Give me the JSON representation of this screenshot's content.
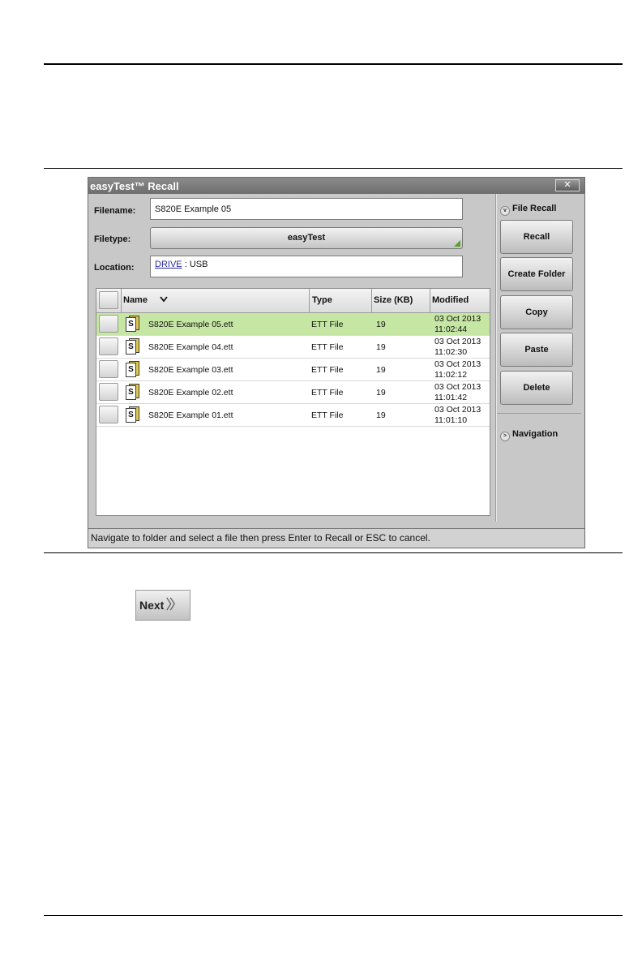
{
  "window": {
    "title": "easyTest™ Recall",
    "close_glyph": "✕"
  },
  "form": {
    "filename_label": "Filename:",
    "filename_value": "S820E Example 05",
    "filetype_label": "Filetype:",
    "filetype_value": "easyTest",
    "location_label": "Location:",
    "location_drive": "DRIVE",
    "location_separator": ":",
    "location_value": "USB"
  },
  "table": {
    "headers": {
      "name": "Name",
      "type": "Type",
      "size": "Size (KB)",
      "modified": "Modified"
    },
    "sort_icon": "chevron-down",
    "rows": [
      {
        "icon_letter": "S",
        "name": "S820E Example 05.ett",
        "type": "ETT File",
        "size": "19",
        "date": "03 Oct 2013",
        "time": "11:02:44",
        "selected": true
      },
      {
        "icon_letter": "S",
        "name": "S820E Example 04.ett",
        "type": "ETT File",
        "size": "19",
        "date": "03 Oct 2013",
        "time": "11:02:30",
        "selected": false
      },
      {
        "icon_letter": "S",
        "name": "S820E Example 03.ett",
        "type": "ETT File",
        "size": "19",
        "date": "03 Oct 2013",
        "time": "11:02:12",
        "selected": false
      },
      {
        "icon_letter": "S",
        "name": "S820E Example 02.ett",
        "type": "ETT File",
        "size": "19",
        "date": "03 Oct 2013",
        "time": "11:01:42",
        "selected": false
      },
      {
        "icon_letter": "S",
        "name": "S820E Example 01.ett",
        "type": "ETT File",
        "size": "19",
        "date": "03 Oct 2013",
        "time": "11:01:10",
        "selected": false
      }
    ]
  },
  "sidebar": {
    "file_recall_label": "File Recall",
    "buttons": [
      "Recall",
      "Create Folder",
      "Copy",
      "Paste",
      "Delete"
    ],
    "navigation_label": "Navigation"
  },
  "status": {
    "text": "Navigate to folder and select a file then press Enter to Recall or ESC to cancel."
  },
  "next": {
    "label": "Next",
    "arrows": "〉〉"
  },
  "colors": {
    "selected_row": "#c6e6a4",
    "titlebar": "#7c7c7c",
    "corner_accent": "#5aa02c"
  }
}
